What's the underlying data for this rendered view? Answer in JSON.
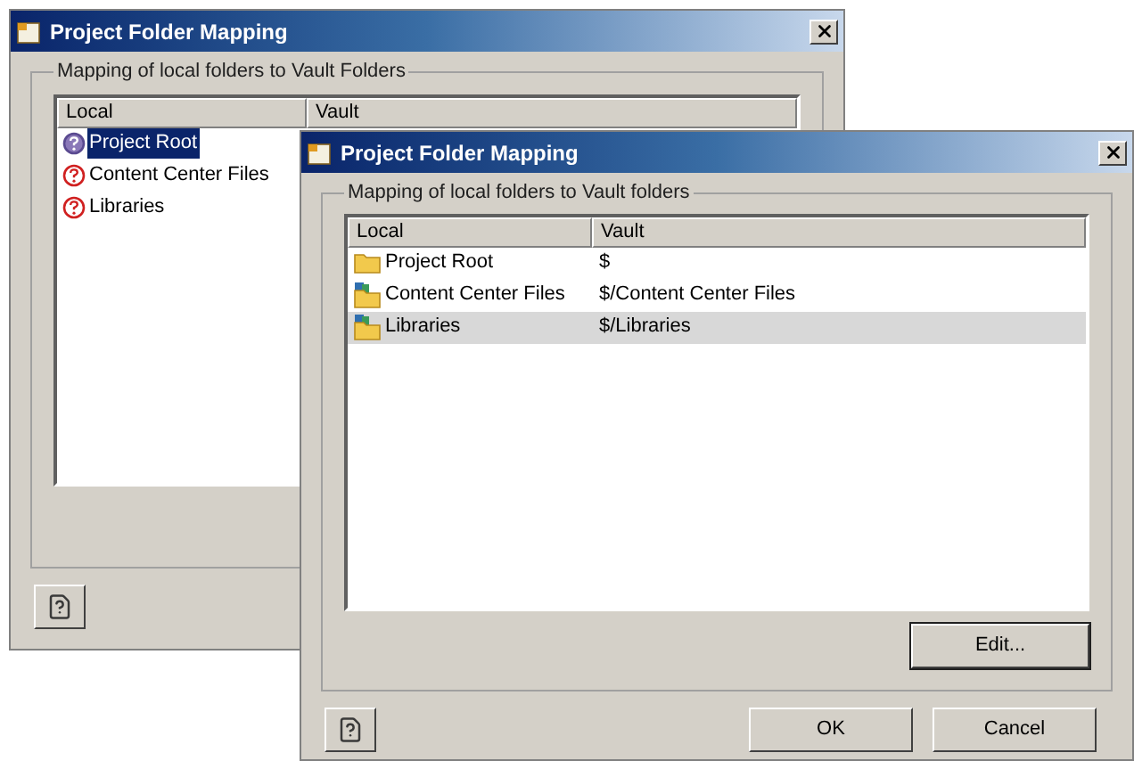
{
  "windows": [
    {
      "title": "Project Folder Mapping",
      "group_label": "Mapping of local folders to Vault Folders",
      "columns": [
        "Local",
        "Vault"
      ],
      "rows": [
        {
          "kind": "unresolved",
          "local": "Project Root",
          "selected": true
        },
        {
          "kind": "unresolved",
          "local": "Content Center Files",
          "selected": false
        },
        {
          "kind": "unresolved",
          "local": "Libraries",
          "selected": false
        }
      ],
      "buttons": [
        {
          "kind": "help"
        }
      ]
    },
    {
      "title": "Project Folder Mapping",
      "group_label": "Mapping of local folders to Vault folders",
      "columns": [
        "Local",
        "Vault"
      ],
      "rows": [
        {
          "kind": "folder",
          "local": "Project Root",
          "vault": "$",
          "selected": false
        },
        {
          "kind": "library",
          "local": "Content Center Files",
          "vault": "$/Content Center Files",
          "selected": false
        },
        {
          "kind": "library",
          "local": "Libraries",
          "vault": "$/Libraries",
          "selected": true
        }
      ],
      "buttons": [
        {
          "kind": "edit",
          "label": "Edit..."
        },
        {
          "kind": "help"
        },
        {
          "kind": "ok",
          "label": "OK"
        },
        {
          "kind": "cancel",
          "label": "Cancel"
        }
      ]
    }
  ]
}
